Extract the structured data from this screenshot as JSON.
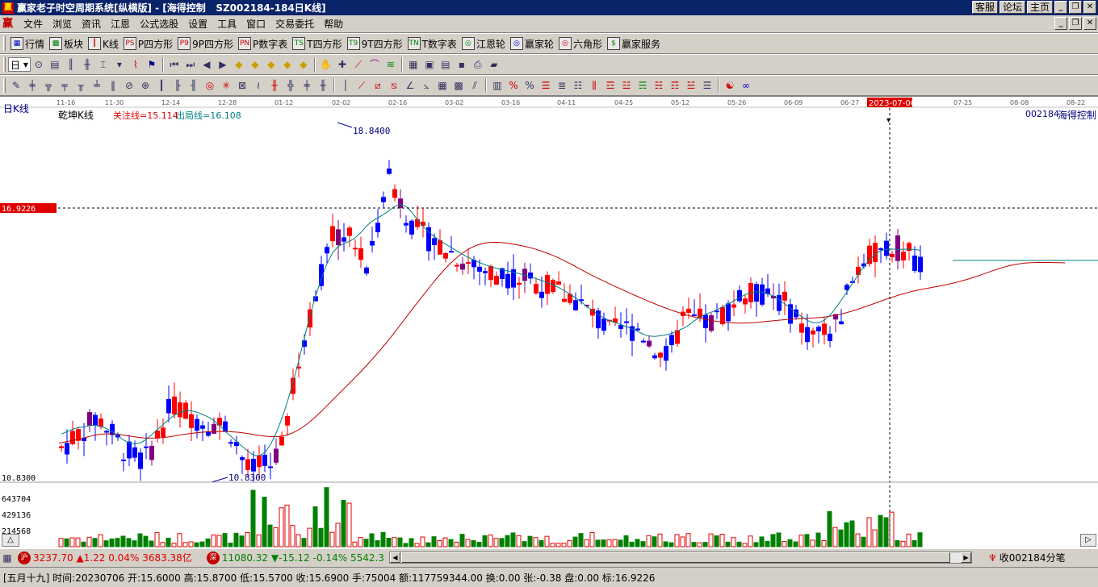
{
  "window": {
    "title": "赢家老子时空周期系统[纵横版] - [海得控制   SZ002184-184日K线]",
    "links": [
      "客服",
      "论坛",
      "主页"
    ]
  },
  "menu": [
    "文件",
    "浏览",
    "资讯",
    "江恩",
    "公式选股",
    "设置",
    "工具",
    "窗口",
    "交易委托",
    "帮助"
  ],
  "toolbar1": [
    {
      "label": "行情",
      "icon": "grid-icon"
    },
    {
      "label": "板块",
      "icon": "blocks-icon"
    },
    {
      "label": "K线",
      "icon": "candles-icon"
    },
    {
      "label": "P四方形",
      "icon": "ps-icon",
      "badge": "PS"
    },
    {
      "label": "9P四方形",
      "icon": "p9-icon",
      "badge": "P9"
    },
    {
      "label": "P数字表",
      "icon": "pn-icon",
      "badge": "PN"
    },
    {
      "label": "T四方形",
      "icon": "ts-icon",
      "badge": "TS"
    },
    {
      "label": "9T四方形",
      "icon": "t9-icon",
      "badge": "T9"
    },
    {
      "label": "T数字表",
      "icon": "tn-icon",
      "badge": "TN"
    },
    {
      "label": "江恩轮",
      "icon": "gann-wheel-icon",
      "badge": "◎"
    },
    {
      "label": "赢家轮",
      "icon": "winner-wheel-icon",
      "badge": "◎"
    },
    {
      "label": "六角形",
      "icon": "hexagon-icon",
      "badge": "◎"
    },
    {
      "label": "赢家服务",
      "icon": "dollar-icon",
      "badge": "$"
    }
  ],
  "toolbar2_period": "日",
  "chart": {
    "left_label": "日K线",
    "indicator_name": "乾坤K线",
    "guanzhu_text": "关注线=15.114",
    "chuju_text": "出局线=16.108",
    "stock_code": "002184",
    "stock_name": "海得控制",
    "price_marker": "16.9226",
    "high_label": "18.8400",
    "low_label": "10.8300",
    "low_axis_label": "10.8300",
    "date_cursor": "2023-07-06",
    "date_ticks": [
      "11-16",
      "11-30",
      "12-14",
      "12-28",
      "01-12",
      "02-02",
      "02-16",
      "03-02",
      "03-16",
      "04-11",
      "04-25",
      "05-12",
      "05-26",
      "06-09",
      "06-27",
      "07-25",
      "08-08",
      "08-22"
    ],
    "vol_labels": [
      "643704",
      "429136",
      "214568"
    ],
    "colors": {
      "up": "#ff0000",
      "down": "#0000ff",
      "purple": "#800080",
      "ma_fast": "#008080",
      "ma_slow": "#c00000"
    }
  },
  "status1": {
    "sh_badge": "沪",
    "sh_index": "3237.70",
    "sh_change": "▲1.22",
    "sh_pct": "0.04%",
    "sh_amount": "3683.38亿",
    "sz_badge": "深",
    "sz_index": "11080.32",
    "sz_change": "▼-15.12",
    "sz_pct": "-0.14%",
    "sz_amount": "5542.3",
    "right_text": "收002184分笔"
  },
  "status2": {
    "text": "[五月十九] 时间:20230706 开:15.6000 高:15.8700 低:15.5700 收:15.6900 手:75004 额:117759344.00 换:0.00 张:-0.38 盘:0.00 标:16.9226"
  }
}
